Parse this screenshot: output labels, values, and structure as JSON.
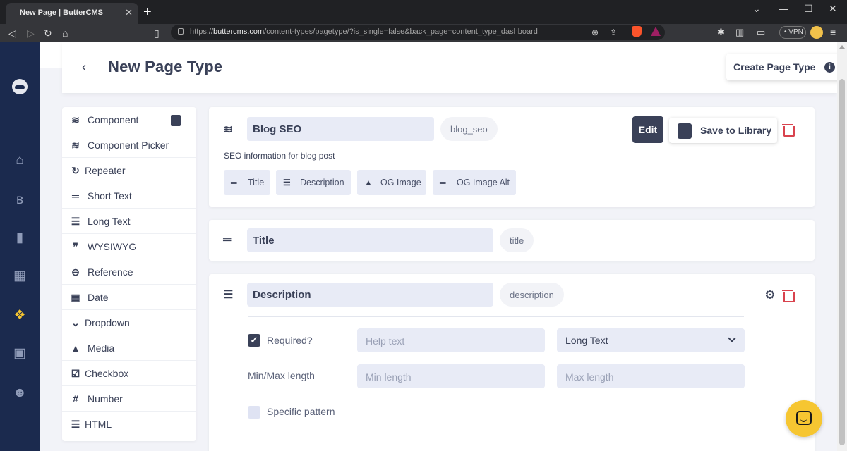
{
  "browser": {
    "tab_title": "New Page | ButterCMS",
    "new_tab": "+",
    "url_prefix": "https://",
    "url_domain": "buttercms.com",
    "url_path": "/content-types/pagetype/?is_single=false&back_page=content_type_dashboard",
    "vpn": "VPN"
  },
  "sidebar": {
    "icons": [
      "buttercms-logo-icon",
      "home-icon",
      "blog-icon",
      "pages-icon",
      "collections-icon",
      "content-types-icon",
      "media-icon",
      "users-icon"
    ],
    "accent": "#f6c631"
  },
  "header": {
    "title": "New Page Type",
    "create_label": "Create Page Type",
    "info": "i"
  },
  "palette": {
    "items": [
      {
        "label": "Component",
        "icon": "layers-icon"
      },
      {
        "label": "Component Picker",
        "icon": "layers-plus-icon"
      },
      {
        "label": "Repeater",
        "icon": "repeat-icon"
      },
      {
        "label": "Short Text",
        "icon": "short-text-icon"
      },
      {
        "label": "Long Text",
        "icon": "long-text-icon"
      },
      {
        "label": "WYSIWYG",
        "icon": "quote-icon"
      },
      {
        "label": "Reference",
        "icon": "link-icon"
      },
      {
        "label": "Date",
        "icon": "calendar-icon"
      },
      {
        "label": "Dropdown",
        "icon": "chevron-down-icon"
      },
      {
        "label": "Media",
        "icon": "image-icon"
      },
      {
        "label": "Checkbox",
        "icon": "checkbox-icon"
      },
      {
        "label": "Number",
        "icon": "hash-icon"
      },
      {
        "label": "HTML",
        "icon": "html-icon"
      }
    ]
  },
  "component": {
    "name": "Blog SEO",
    "key": "blog_seo",
    "description": "SEO information for blog post",
    "edit": "Edit",
    "save_library": "Save to Library",
    "fields": [
      "Title",
      "Description",
      "OG Image",
      "OG Image Alt"
    ]
  },
  "title_field": {
    "name": "Title",
    "key": "title"
  },
  "description_field": {
    "name": "Description",
    "key": "description",
    "required_label": "Required?",
    "help_placeholder": "Help text",
    "type_value": "Long Text",
    "minmax_label": "Min/Max length",
    "min_placeholder": "Min length",
    "max_placeholder": "Max length",
    "pattern_label": "Specific pattern"
  },
  "colors": {
    "primary": "#3a4158",
    "danger": "#d9434e",
    "sidebar_bg": "#1b2a4e",
    "accent": "#f6c631"
  }
}
